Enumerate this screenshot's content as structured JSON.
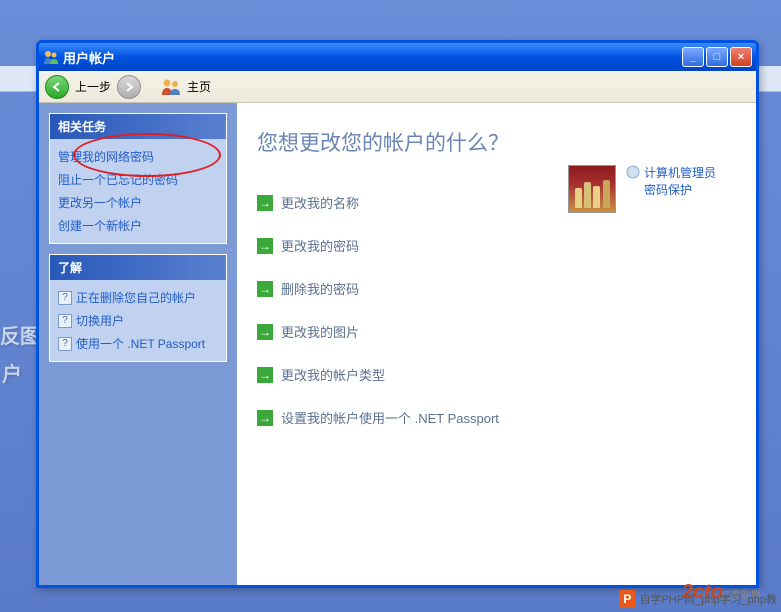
{
  "background": {
    "text1": "反图",
    "text2": "户"
  },
  "window": {
    "title": "用户帐户"
  },
  "toolbar": {
    "back_label": "上一步",
    "home_label": "主页"
  },
  "sidebar": {
    "tasks": {
      "header": "相关任务",
      "items": [
        "管理我的网络密码",
        "阻止一个已忘记的密码",
        "更改另一个帐户",
        "创建一个新帐户"
      ]
    },
    "help": {
      "header": "了解",
      "items": [
        "正在删除您自己的帐户",
        "切换用户",
        "使用一个 .NET Passport"
      ]
    }
  },
  "main": {
    "title": "您想更改您的帐户的什么？",
    "account": {
      "line1": "计算机管理员",
      "line2": "密码保护"
    },
    "actions": [
      "更改我的名称",
      "更改我的密码",
      "删除我的密码",
      "更改我的图片",
      "更改我的帐户类型",
      "设置我的帐户使用一个 .NET Passport"
    ]
  },
  "footer": {
    "badge": "P",
    "text": "自学PHP网_php学习_php教",
    "logo": "2cto",
    "cn": "红黑联盟"
  }
}
